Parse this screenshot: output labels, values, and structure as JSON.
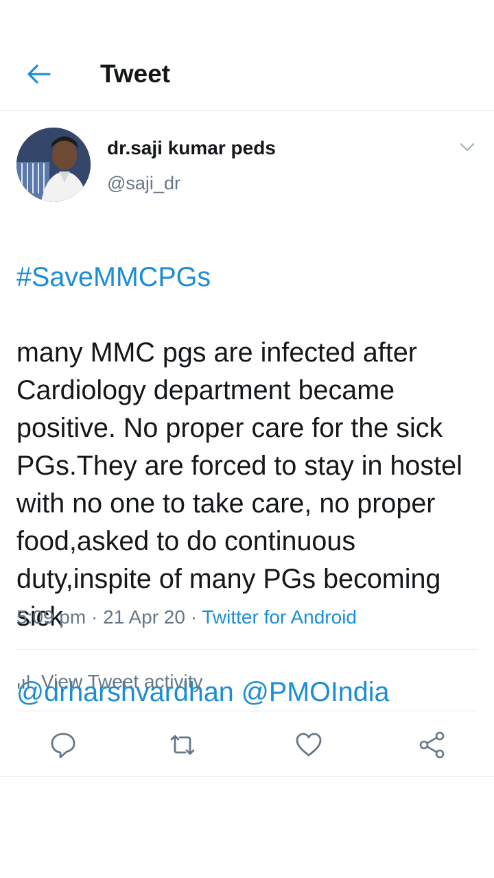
{
  "header": {
    "title": "Tweet"
  },
  "author": {
    "name": "dr.saji kumar peds",
    "handle": "@saji_dr"
  },
  "tweet": {
    "hashtag": "#SaveMMCPGs",
    "body": "many MMC pgs are infected after Cardiology department became positive. No proper care for the sick PGs.They are forced to stay in hostel with no one to take care, no proper food,asked to do continuous duty,inspite of many PGs becoming sick",
    "mentions": "@drharshvardhan @PMOIndia"
  },
  "meta": {
    "time": "5:09 pm",
    "date": "21 Apr 20",
    "separator": " · ",
    "source": "Twitter for Android"
  },
  "activity": {
    "label": "View Tweet activity"
  },
  "actions": {
    "icons": [
      "reply-icon",
      "retweet-icon",
      "like-icon",
      "share-icon"
    ]
  },
  "colors": {
    "link": "#1b8dd6",
    "text": "#14171a",
    "secondary": "#657786",
    "divider": "#e1e8ed"
  }
}
